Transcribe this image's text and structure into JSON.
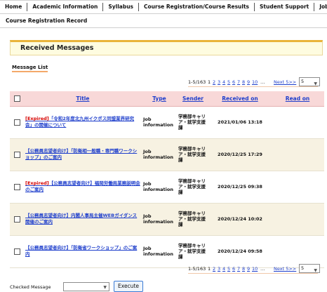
{
  "nav": {
    "items": [
      "Home",
      "Academic Information",
      "Syllabus",
      "Course Registration/Course Results",
      "Student Support",
      "Job S"
    ]
  },
  "subnav": {
    "record_label": "Course Registration Record"
  },
  "banner": {
    "title": "Received Messages"
  },
  "section": {
    "label": "Message List"
  },
  "pager": {
    "summary": "1-5/163",
    "pages": [
      "1",
      "2",
      "3",
      "4",
      "5",
      "6",
      "7",
      "8",
      "9",
      "10"
    ],
    "current_page": "1",
    "ellipsis": "…",
    "next_label": "Next 5>>",
    "page_size": "5"
  },
  "table": {
    "headers": {
      "title": "Title",
      "type": "Type",
      "sender": "Sender",
      "received_on": "Received on",
      "read_on": "Read on"
    },
    "rows": [
      {
        "expired": "[Expired]",
        "title": "「令和2年度北九州イクボス同盟業界研究会」の開催について",
        "type": "Job information",
        "sender": "学務部キャリア・就学支援課",
        "received_on": "2021/01/06 13:18",
        "read_on": ""
      },
      {
        "expired": "",
        "title": "【公務員志望者向け】「防衛相一般職・専門職ワークショップ」のご案内",
        "type": "Job information",
        "sender": "学務部キャリア・就学支援課",
        "received_on": "2020/12/25 17:29",
        "read_on": ""
      },
      {
        "expired": "[Expired]",
        "title": "【公務員志望者向け】福岡労働局業務説明会のご案内",
        "type": "Job information",
        "sender": "学務部キャリア・就学支援課",
        "received_on": "2020/12/25 09:38",
        "read_on": ""
      },
      {
        "expired": "",
        "title": "【公務員志望者向け】内閣人事局主催WEBガイダンス開催のご案内",
        "type": "Job information",
        "sender": "学務部キャリア・就学支援課",
        "received_on": "2020/12/24 10:02",
        "read_on": ""
      },
      {
        "expired": "",
        "title": "【公務員志望者向け】「防衛省ワークショップ」のご案内",
        "type": "Job information",
        "sender": "学務部キャリア・就学支援課",
        "received_on": "2020/12/24 09:58",
        "read_on": ""
      }
    ]
  },
  "bottom": {
    "checked_label": "Checked Message",
    "action_value": "",
    "execute_label": "Execute"
  }
}
